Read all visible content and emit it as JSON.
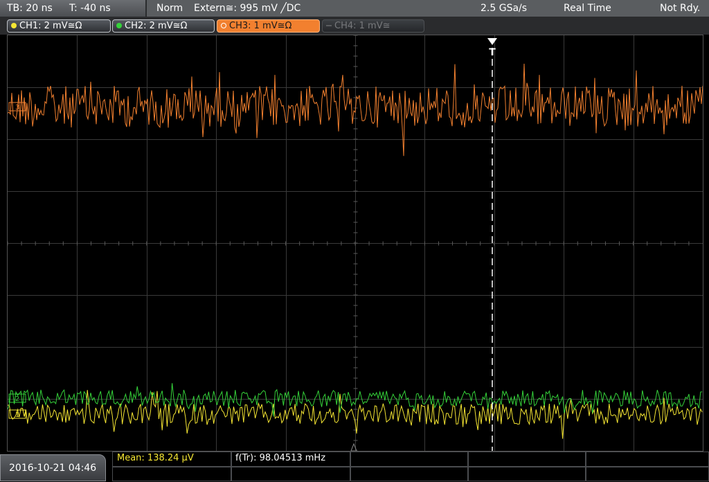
{
  "topbar": {
    "timebase": "TB: 20 ns",
    "trigger_offset": "T: -40 ns",
    "mode": "Norm",
    "trigger": "Extern≅: 995 mV ╱DC",
    "sample_rate": "2.5 GSa/s",
    "acq_mode": "Real Time",
    "status": "Not Rdy."
  },
  "channels": [
    {
      "label": "CH1: 2 mV≅Ω",
      "color": "#f5e633",
      "state": "on"
    },
    {
      "label": "CH2: 2 mV≅Ω",
      "color": "#35d23a",
      "state": "on"
    },
    {
      "label": "CH3: 1 mV≅Ω",
      "color": "#f2802f",
      "state": "active"
    },
    {
      "label": "CH4: 1 mV≅",
      "color": "#6b6d70",
      "state": "off"
    }
  ],
  "markers": {
    "ch1": "1",
    "ch2": "2",
    "ch3": "3",
    "trigger": "T"
  },
  "footer": {
    "datetime": "2016-10-21 04:46",
    "measurement_mean": "Mean: 138.24 µV",
    "measurement_freq": "f(Tr): 98.04513 mHz"
  },
  "colors": {
    "ch1": "#f5e633",
    "ch2": "#35d23a",
    "ch3": "#f2802f",
    "grid": "#3a3a3a",
    "trigger_line": "#ffffff"
  }
}
